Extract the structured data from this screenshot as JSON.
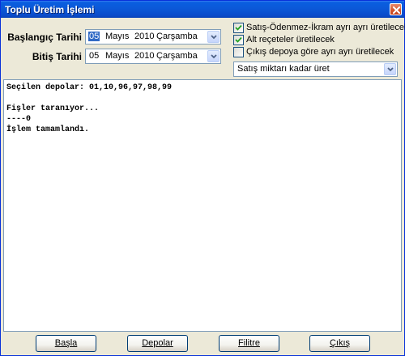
{
  "window": {
    "title": "Toplu Üretim İşlemi"
  },
  "dates": {
    "start_label": "Başlangıç Tarihi",
    "start": {
      "day": "05",
      "month": "Mayıs",
      "year": "2010",
      "weekday": "Çarşamba"
    },
    "end_label": "Bitiş Tarihi",
    "end": {
      "day": "05",
      "month": "Mayıs",
      "year": "2010",
      "weekday": "Çarşamba"
    }
  },
  "options": {
    "checkboxes": [
      {
        "label": "Satış-Ödenmez-İkram ayrı ayrı üretilecek",
        "checked": true
      },
      {
        "label": "Alt reçeteler üretilecek",
        "checked": true
      },
      {
        "label": "Çıkış depoya göre ayrı ayrı üretilecek",
        "checked": false
      }
    ],
    "mode_select": "Satış miktarı kadar üret"
  },
  "log": {
    "lines": [
      "Seçilen depolar: 01,10,96,97,98,99",
      "",
      "Fişler taranıyor...",
      "----0",
      "İşlem tamamlandı."
    ]
  },
  "buttons": {
    "start": "Başla",
    "depots": "Depolar",
    "filter": "Filitre",
    "exit": "Çıkış"
  },
  "colors": {
    "title_bar": "#0a58d8",
    "window_bg": "#ece9d8",
    "selection": "#316ac5",
    "close_button": "#d2542c"
  },
  "icons": {
    "close": "close-x-icon",
    "dropdown": "chevron-down-icon",
    "checkbox_check": "checkmark-icon"
  }
}
